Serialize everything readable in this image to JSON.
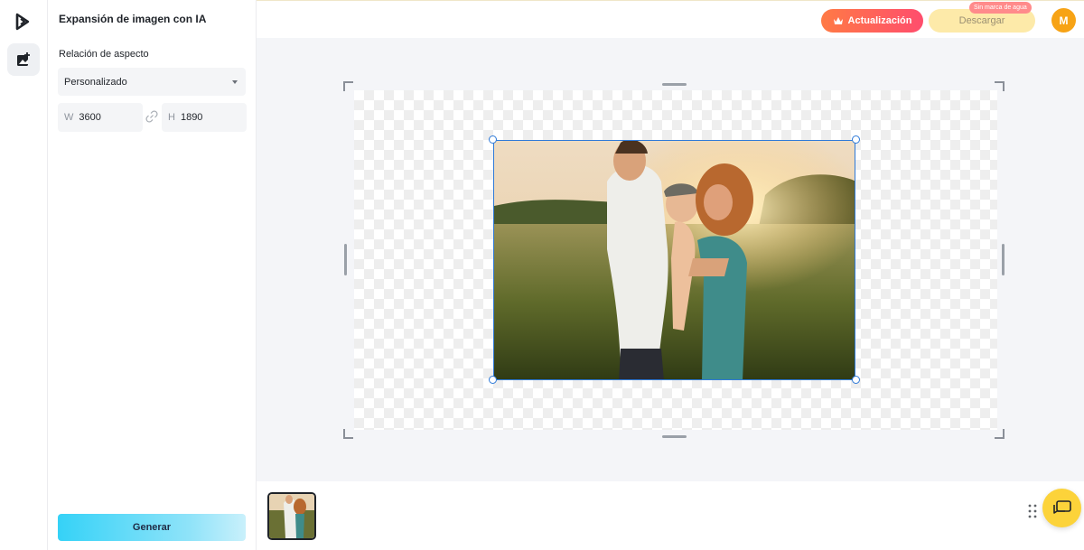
{
  "panel": {
    "title": "Expansión de imagen con IA",
    "aspect_label": "Relación de aspecto",
    "aspect_value": "Personalizado",
    "width_key": "W",
    "width_value": "3600",
    "height_key": "H",
    "height_value": "1890",
    "generate_label": "Generar"
  },
  "header": {
    "upgrade_label": "Actualización",
    "download_label": "Descargar",
    "download_badge": "Sin marca de agua",
    "avatar_initial": "M"
  },
  "colors": {
    "accent_blue": "#2f7ad8",
    "upgrade_gradient": [
      "#ff7a45",
      "#ff4d6d"
    ],
    "download_bg": "#fdeaa9",
    "avatar_bg": "#f7a315",
    "chat_bg": "#fcd33a",
    "generate_gradient": [
      "#35d2f7",
      "#c9f0fb"
    ]
  },
  "icons": [
    "app-logo-icon",
    "image-expand-icon",
    "chevron-down-icon",
    "link-icon",
    "chevron-left-icon",
    "crown-icon",
    "drag-grip-icon",
    "chat-icon"
  ]
}
